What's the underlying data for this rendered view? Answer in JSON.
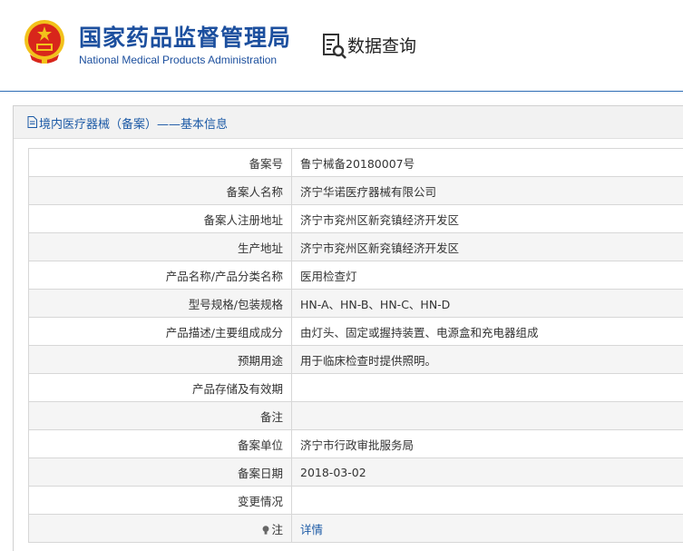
{
  "header": {
    "org_name_cn": "国家药品监督管理局",
    "org_name_en": "National Medical Products Administration",
    "query_label": "数据查询",
    "emblem_icon": "national-emblem-icon",
    "query_icon": "data-query-icon"
  },
  "panel": {
    "title": "境内医疗器械（备案）——基本信息",
    "title_icon": "document-icon"
  },
  "rows": [
    {
      "label": "备案号",
      "value": "鲁宁械备20180007号"
    },
    {
      "label": "备案人名称",
      "value": "济宁华诺医疗器械有限公司"
    },
    {
      "label": "备案人注册地址",
      "value": "济宁市兖州区新兖镇经济开发区"
    },
    {
      "label": "生产地址",
      "value": "济宁市兖州区新兖镇经济开发区"
    },
    {
      "label": "产品名称/产品分类名称",
      "value": "医用检查灯"
    },
    {
      "label": "型号规格/包装规格",
      "value": "HN-A、HN-B、HN-C、HN-D"
    },
    {
      "label": "产品描述/主要组成成分",
      "value": "由灯头、固定或握持装置、电源盒和充电器组成"
    },
    {
      "label": "预期用途",
      "value": "用于临床检查时提供照明。"
    },
    {
      "label": "产品存储及有效期",
      "value": ""
    },
    {
      "label": "备注",
      "value": ""
    },
    {
      "label": "备案单位",
      "value": "济宁市行政审批服务局"
    },
    {
      "label": "备案日期",
      "value": "2018-03-02"
    },
    {
      "label": "变更情况",
      "value": ""
    },
    {
      "label": "注",
      "value": "详情",
      "label_icon": "bulb-icon"
    }
  ],
  "colors": {
    "brand_blue": "#1c4f9e",
    "link_blue": "#1c5aa6",
    "emblem_red": "#d8261b",
    "emblem_gold": "#f2c21b"
  }
}
